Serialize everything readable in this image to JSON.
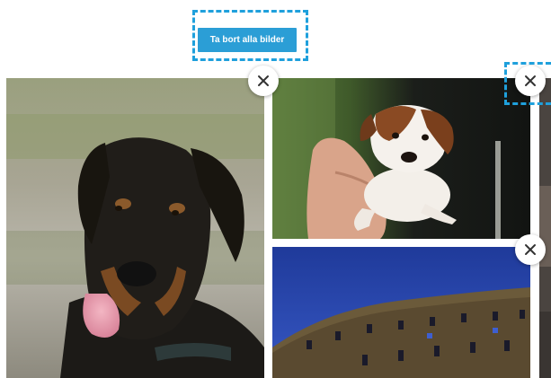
{
  "toolbar": {
    "remove_all_label": "Ta bort alla bilder"
  },
  "gallery": {
    "images": [
      {
        "subject": "doberman-dog",
        "remove_icon": "close-icon"
      },
      {
        "subject": "puppy-in-hand",
        "remove_icon": "close-icon"
      },
      {
        "subject": "colosseum-at-dusk",
        "remove_icon": "close-icon"
      },
      {
        "subject": "partial-photo",
        "remove_icon": "close-icon"
      }
    ]
  },
  "colors": {
    "accent": "#2b9ed6",
    "highlight": "#1fa0dc"
  }
}
